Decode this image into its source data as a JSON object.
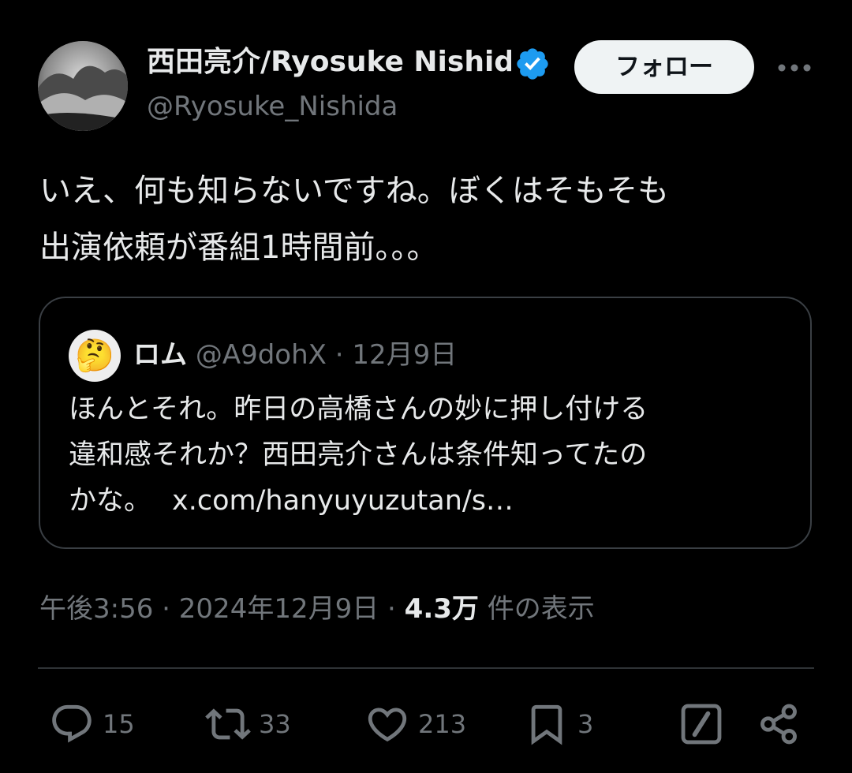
{
  "author": {
    "display_name": "西田亮介/Ryosuke Nishida",
    "handle": "@Ryosuke_Nishida",
    "verified_icon": "verified-badge-icon",
    "follow_label": "フォロー"
  },
  "tweet": {
    "text_line1": "いえ、何も知らないですね。ぼくはそもそも",
    "text_line2": "出演依頼が番組1時間前。。。"
  },
  "quote": {
    "avatar_emoji": "🤔",
    "name": "ロム",
    "handle": "@A9dohX",
    "separator": "·",
    "date": "12月9日",
    "text_line1": "ほんとそれ。昨日の高橋さんの妙に押し付ける",
    "text_line2": "違和感それか？西田亮介さんは条件知ってたの",
    "text_line3": "かな。",
    "link": "x.com/hanyuyuzutan/s…"
  },
  "meta": {
    "time": "午後3:56",
    "sep1": "·",
    "date": "2024年12月9日",
    "sep2": "·",
    "views_count": "4.3万",
    "views_label": "件の表示"
  },
  "actions": {
    "replies": "15",
    "reposts": "33",
    "likes": "213",
    "bookmarks": "3"
  },
  "colors": {
    "background": "#000000",
    "text_primary": "#e7e9ea",
    "text_secondary": "#71767b",
    "verified": "#1d9bf0",
    "border": "#3a3f44"
  }
}
